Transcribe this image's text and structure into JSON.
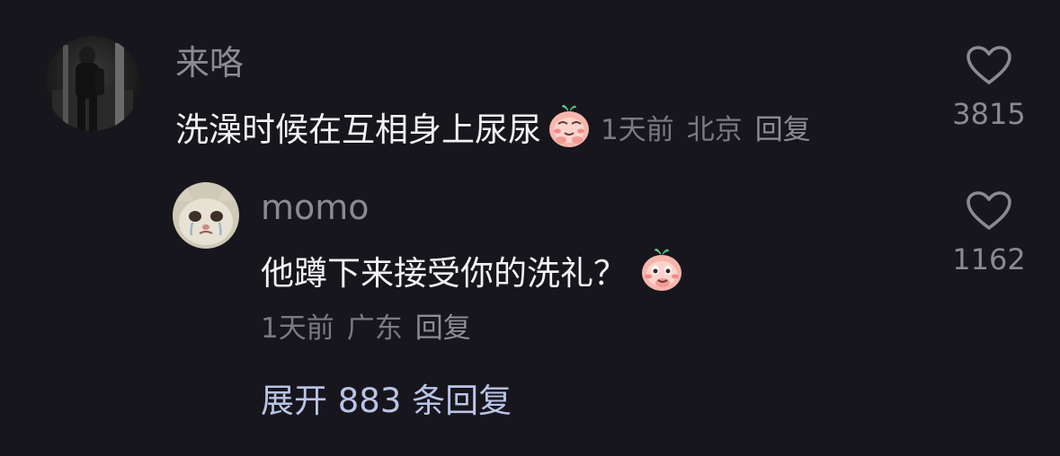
{
  "comments": [
    {
      "author": "来咯",
      "text": "洗澡时候在互相身上尿尿",
      "emoji_icon": "peach-smirk-emoji",
      "time": "1天前",
      "location": "北京",
      "reply_label": "回复",
      "likes": "3815"
    },
    {
      "author": "momo",
      "text": "他蹲下来接受你的洗礼？",
      "emoji_icon": "peach-giggle-emoji",
      "time": "1天前",
      "location": "广东",
      "reply_label": "回复",
      "likes": "1162"
    }
  ],
  "expand_replies": "展开 883 条回复",
  "colors": {
    "background": "#17161c",
    "muted_text": "#8b8a91",
    "link": "#b9c4e6",
    "emoji_peach": "#f6b6ae"
  }
}
